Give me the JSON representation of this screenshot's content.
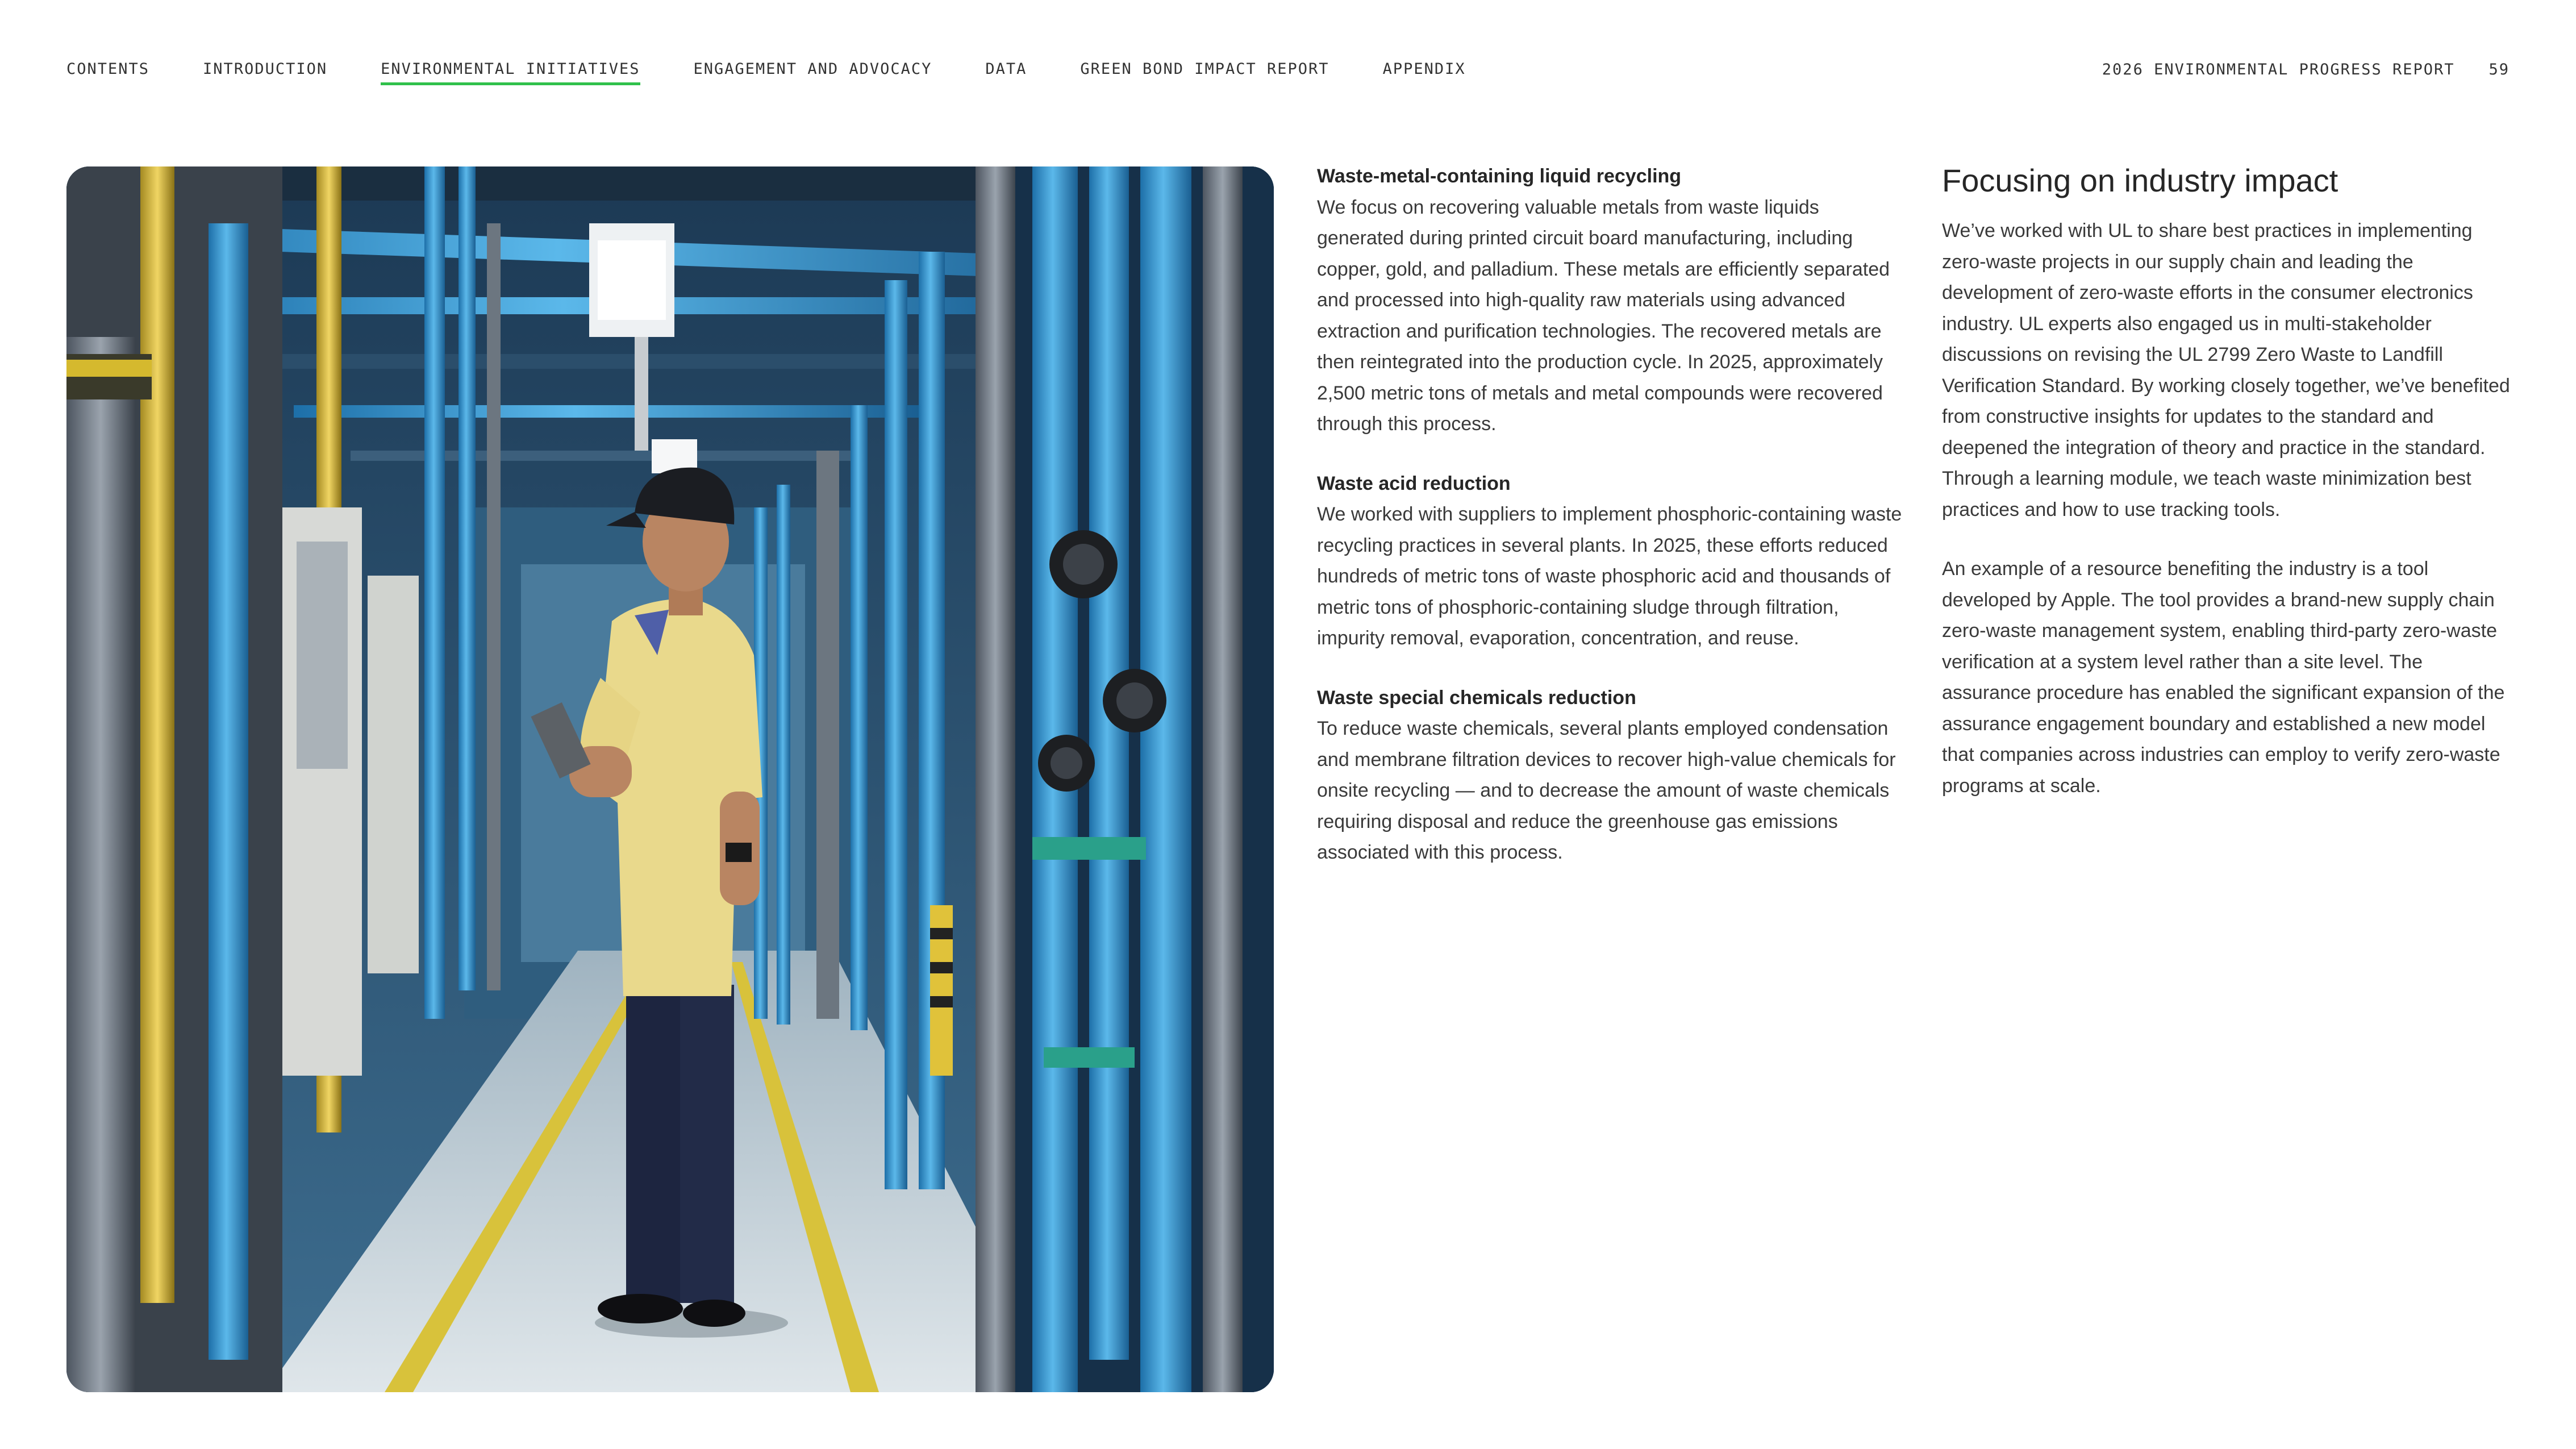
{
  "nav": {
    "items": [
      {
        "label": "CONTENTS"
      },
      {
        "label": "INTRODUCTION"
      },
      {
        "label": "ENVIRONMENTAL INITIATIVES"
      },
      {
        "label": "ENGAGEMENT AND ADVOCACY"
      },
      {
        "label": "DATA"
      },
      {
        "label": "GREEN BOND IMPACT REPORT"
      },
      {
        "label": "APPENDIX"
      }
    ],
    "active_index": 2,
    "active_color": "#30c14b"
  },
  "report": {
    "title": "2026 ENVIRONMENTAL PROGRESS REPORT",
    "page_number": "59"
  },
  "photo": {
    "icon": "factory-worker-photo"
  },
  "sections": [
    {
      "heading": "Waste-metal-containing liquid recycling",
      "body": "We focus on recovering valuable metals from waste liquids generated during printed circuit board manufacturing, including copper, gold, and palladium. These metals are efficiently separated and processed into high-quality raw materials using advanced extraction and purification technologies. The recovered metals are then reintegrated into the production cycle. In 2025, approximately 2,500 metric tons of metals and metal compounds were recovered through this process."
    },
    {
      "heading": "Waste acid reduction",
      "body": "We worked with suppliers to implement phosphoric-containing waste recycling practices in several plants. In 2025, these efforts reduced hundreds of metric tons of waste phosphoric acid and thousands of metric tons of phosphoric-containing sludge through filtration, impurity removal, evaporation, concentration, and reuse."
    },
    {
      "heading": "Waste special chemicals reduction",
      "body": "To reduce waste chemicals, several plants employed condensation and membrane filtration devices to recover high-value chemicals for onsite recycling — and to decrease the amount of waste chemicals requiring disposal and reduce the greenhouse gas emissions associated with this process."
    }
  ],
  "right": {
    "title": "Focusing on industry impact",
    "paragraphs": [
      "We’ve worked with UL to share best practices in implementing zero-waste projects in our supply chain and leading the development of zero-waste efforts in the consumer electronics industry. UL experts also engaged us in multi-stakeholder discussions on revising the UL 2799 Zero Waste to Landfill Verification Standard. By working closely together, we’ve benefited from constructive insights for updates to the standard and deepened the integration of theory and practice in the standard. Through a learning module, we teach waste minimization best practices and how to use tracking tools.",
      "An example of a resource benefiting the industry is a tool developed by Apple. The tool provides a brand-new supply chain zero-waste management system, enabling third-party zero-waste verification at a system level rather than a site level. The assurance procedure has enabled the significant expansion of the assurance engagement boundary and established a new model that companies across industries can employ to verify zero-waste programs at scale."
    ]
  }
}
